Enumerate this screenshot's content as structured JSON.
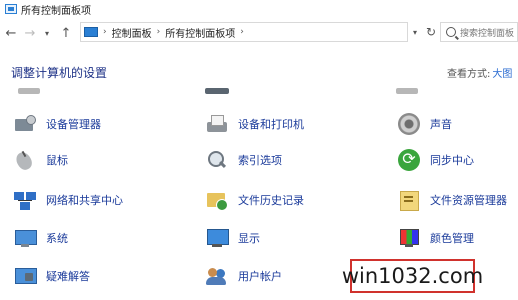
{
  "window": {
    "title": "所有控制面板项"
  },
  "navigation": {
    "back_icon": "arrow-left",
    "forward_icon": "arrow-right",
    "recent_icon": "chevron-down",
    "up_icon": "arrow-up",
    "breadcrumb": [
      "控制面板",
      "所有控制面板项"
    ],
    "separator": "›",
    "dropdown_icon": "chevron-down",
    "refresh_icon": "refresh",
    "search_placeholder": "搜索控制面板"
  },
  "header": {
    "title": "调整计算机的设置",
    "view_by_label": "查看方式:",
    "view_by_value": "大图"
  },
  "items": [
    {
      "label": "设备管理器",
      "icon": "device-manager-icon"
    },
    {
      "label": "设备和打印机",
      "icon": "printer-icon"
    },
    {
      "label": "声音",
      "icon": "speaker-icon"
    },
    {
      "label": "鼠标",
      "icon": "mouse-icon"
    },
    {
      "label": "索引选项",
      "icon": "magnifier-icon"
    },
    {
      "label": "同步中心",
      "icon": "sync-icon"
    },
    {
      "label": "网络和共享中心",
      "icon": "network-icon"
    },
    {
      "label": "文件历史记录",
      "icon": "file-history-icon"
    },
    {
      "label": "文件资源管理器",
      "icon": "file-explorer-icon"
    },
    {
      "label": "系统",
      "icon": "system-icon"
    },
    {
      "label": "显示",
      "icon": "display-icon"
    },
    {
      "label": "颜色管理",
      "icon": "color-management-icon"
    },
    {
      "label": "疑难解答",
      "icon": "troubleshooting-icon"
    },
    {
      "label": "用户帐户",
      "icon": "user-accounts-icon"
    }
  ],
  "watermark": {
    "text": "win1032.com",
    "border_color": "#d0322d"
  },
  "colors": {
    "link": "#1a3a9a",
    "title": "#1e3287",
    "view_value": "#2a6bd1"
  }
}
